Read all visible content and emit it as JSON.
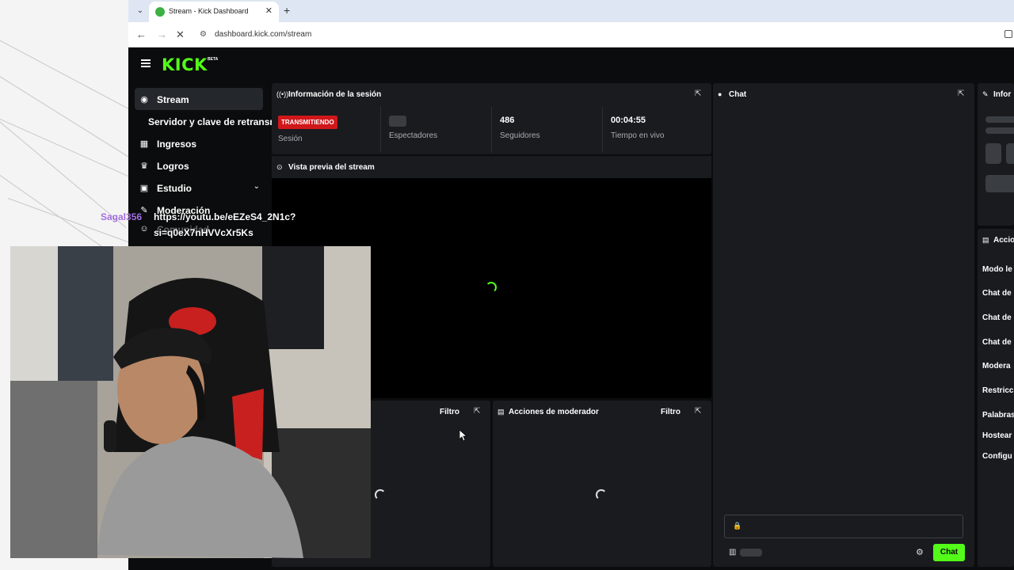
{
  "browser": {
    "tab_title": "Stream - Kick Dashboard",
    "url": "dashboard.kick.com/stream"
  },
  "header": {
    "logo": "KICK",
    "logo_badge": "BETA"
  },
  "sidebar": {
    "items": [
      {
        "label": "Stream",
        "icon": "broadcast-icon",
        "active": true
      },
      {
        "label": "Servidor y clave de retransm",
        "icon": "",
        "active": false
      },
      {
        "label": "Ingresos",
        "icon": "chart-icon",
        "active": false
      },
      {
        "label": "Logros",
        "icon": "trophy-icon",
        "active": false
      },
      {
        "label": "Estudio",
        "icon": "studio-icon",
        "active": false
      },
      {
        "label": "Moderación",
        "icon": "wrench-icon",
        "active": false
      },
      {
        "label": "Comunidad",
        "icon": "users-icon",
        "active": false
      }
    ]
  },
  "session": {
    "title": "Información de la sesión",
    "status_badge": "TRANSMITIENDO",
    "stats": [
      {
        "value": "",
        "label": "Sesión"
      },
      {
        "value": "",
        "label": "Espectadores"
      },
      {
        "value": "486",
        "label": "Seguidores"
      },
      {
        "value": "00:04:55",
        "label": "Tiempo en vivo"
      }
    ]
  },
  "preview": {
    "title": "Vista previa del stream"
  },
  "activity": {
    "title": "",
    "filter_label": "Filtro"
  },
  "mod_actions": {
    "title": "Acciones de moderador",
    "filter_label": "Filtro"
  },
  "chat": {
    "title": "Chat",
    "send_label": "Chat",
    "input_placeholder": ""
  },
  "info_panel": {
    "title": "Infor"
  },
  "mod_panel": {
    "title": "Accio",
    "items": [
      "Modo le",
      "Chat de",
      "Chat de",
      "Chat de",
      "Modera",
      "Restricc",
      "Palabras",
      "Hostear",
      "Configu"
    ]
  },
  "overlay": {
    "username": "Sagal356",
    "message_lines": [
      "https://youtu.be/eEZeS4_2N1c?",
      "si=q0eX7nHVVcXr5Ks"
    ]
  },
  "colors": {
    "accent": "#53fc18",
    "live": "#d0171a",
    "panel": "#191b1f",
    "background": "#0b0c0d"
  }
}
